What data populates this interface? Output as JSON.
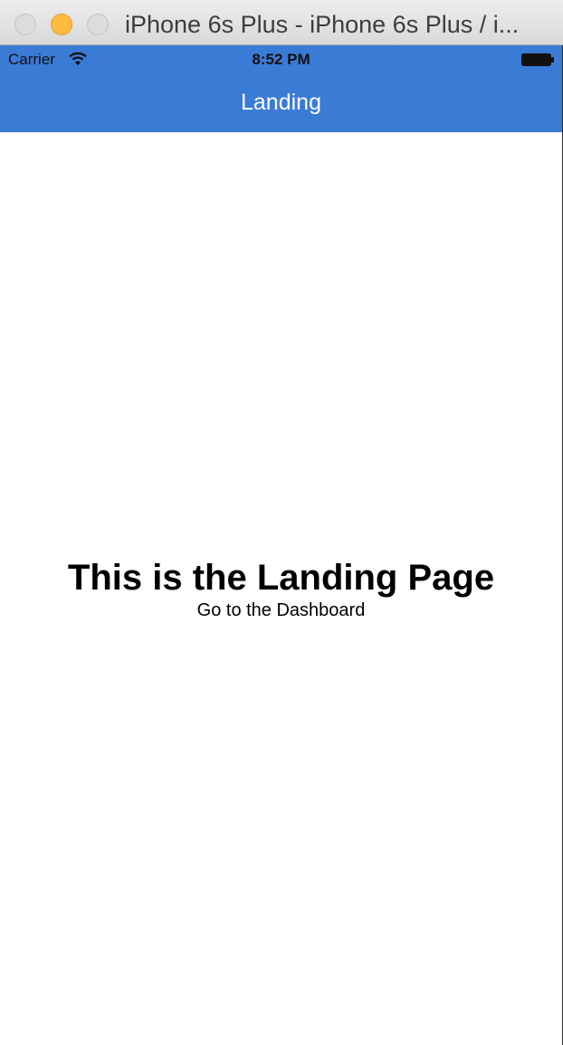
{
  "window": {
    "title": "iPhone 6s Plus - iPhone 6s Plus / i..."
  },
  "status_bar": {
    "carrier": "Carrier",
    "time": "8:52 PM",
    "wifi_icon": "wifi-icon",
    "battery_icon": "battery-icon"
  },
  "nav_bar": {
    "title": "Landing",
    "background_color": "#3a7bd5"
  },
  "main": {
    "heading": "This is the Landing Page",
    "link_label": "Go to the Dashboard"
  }
}
